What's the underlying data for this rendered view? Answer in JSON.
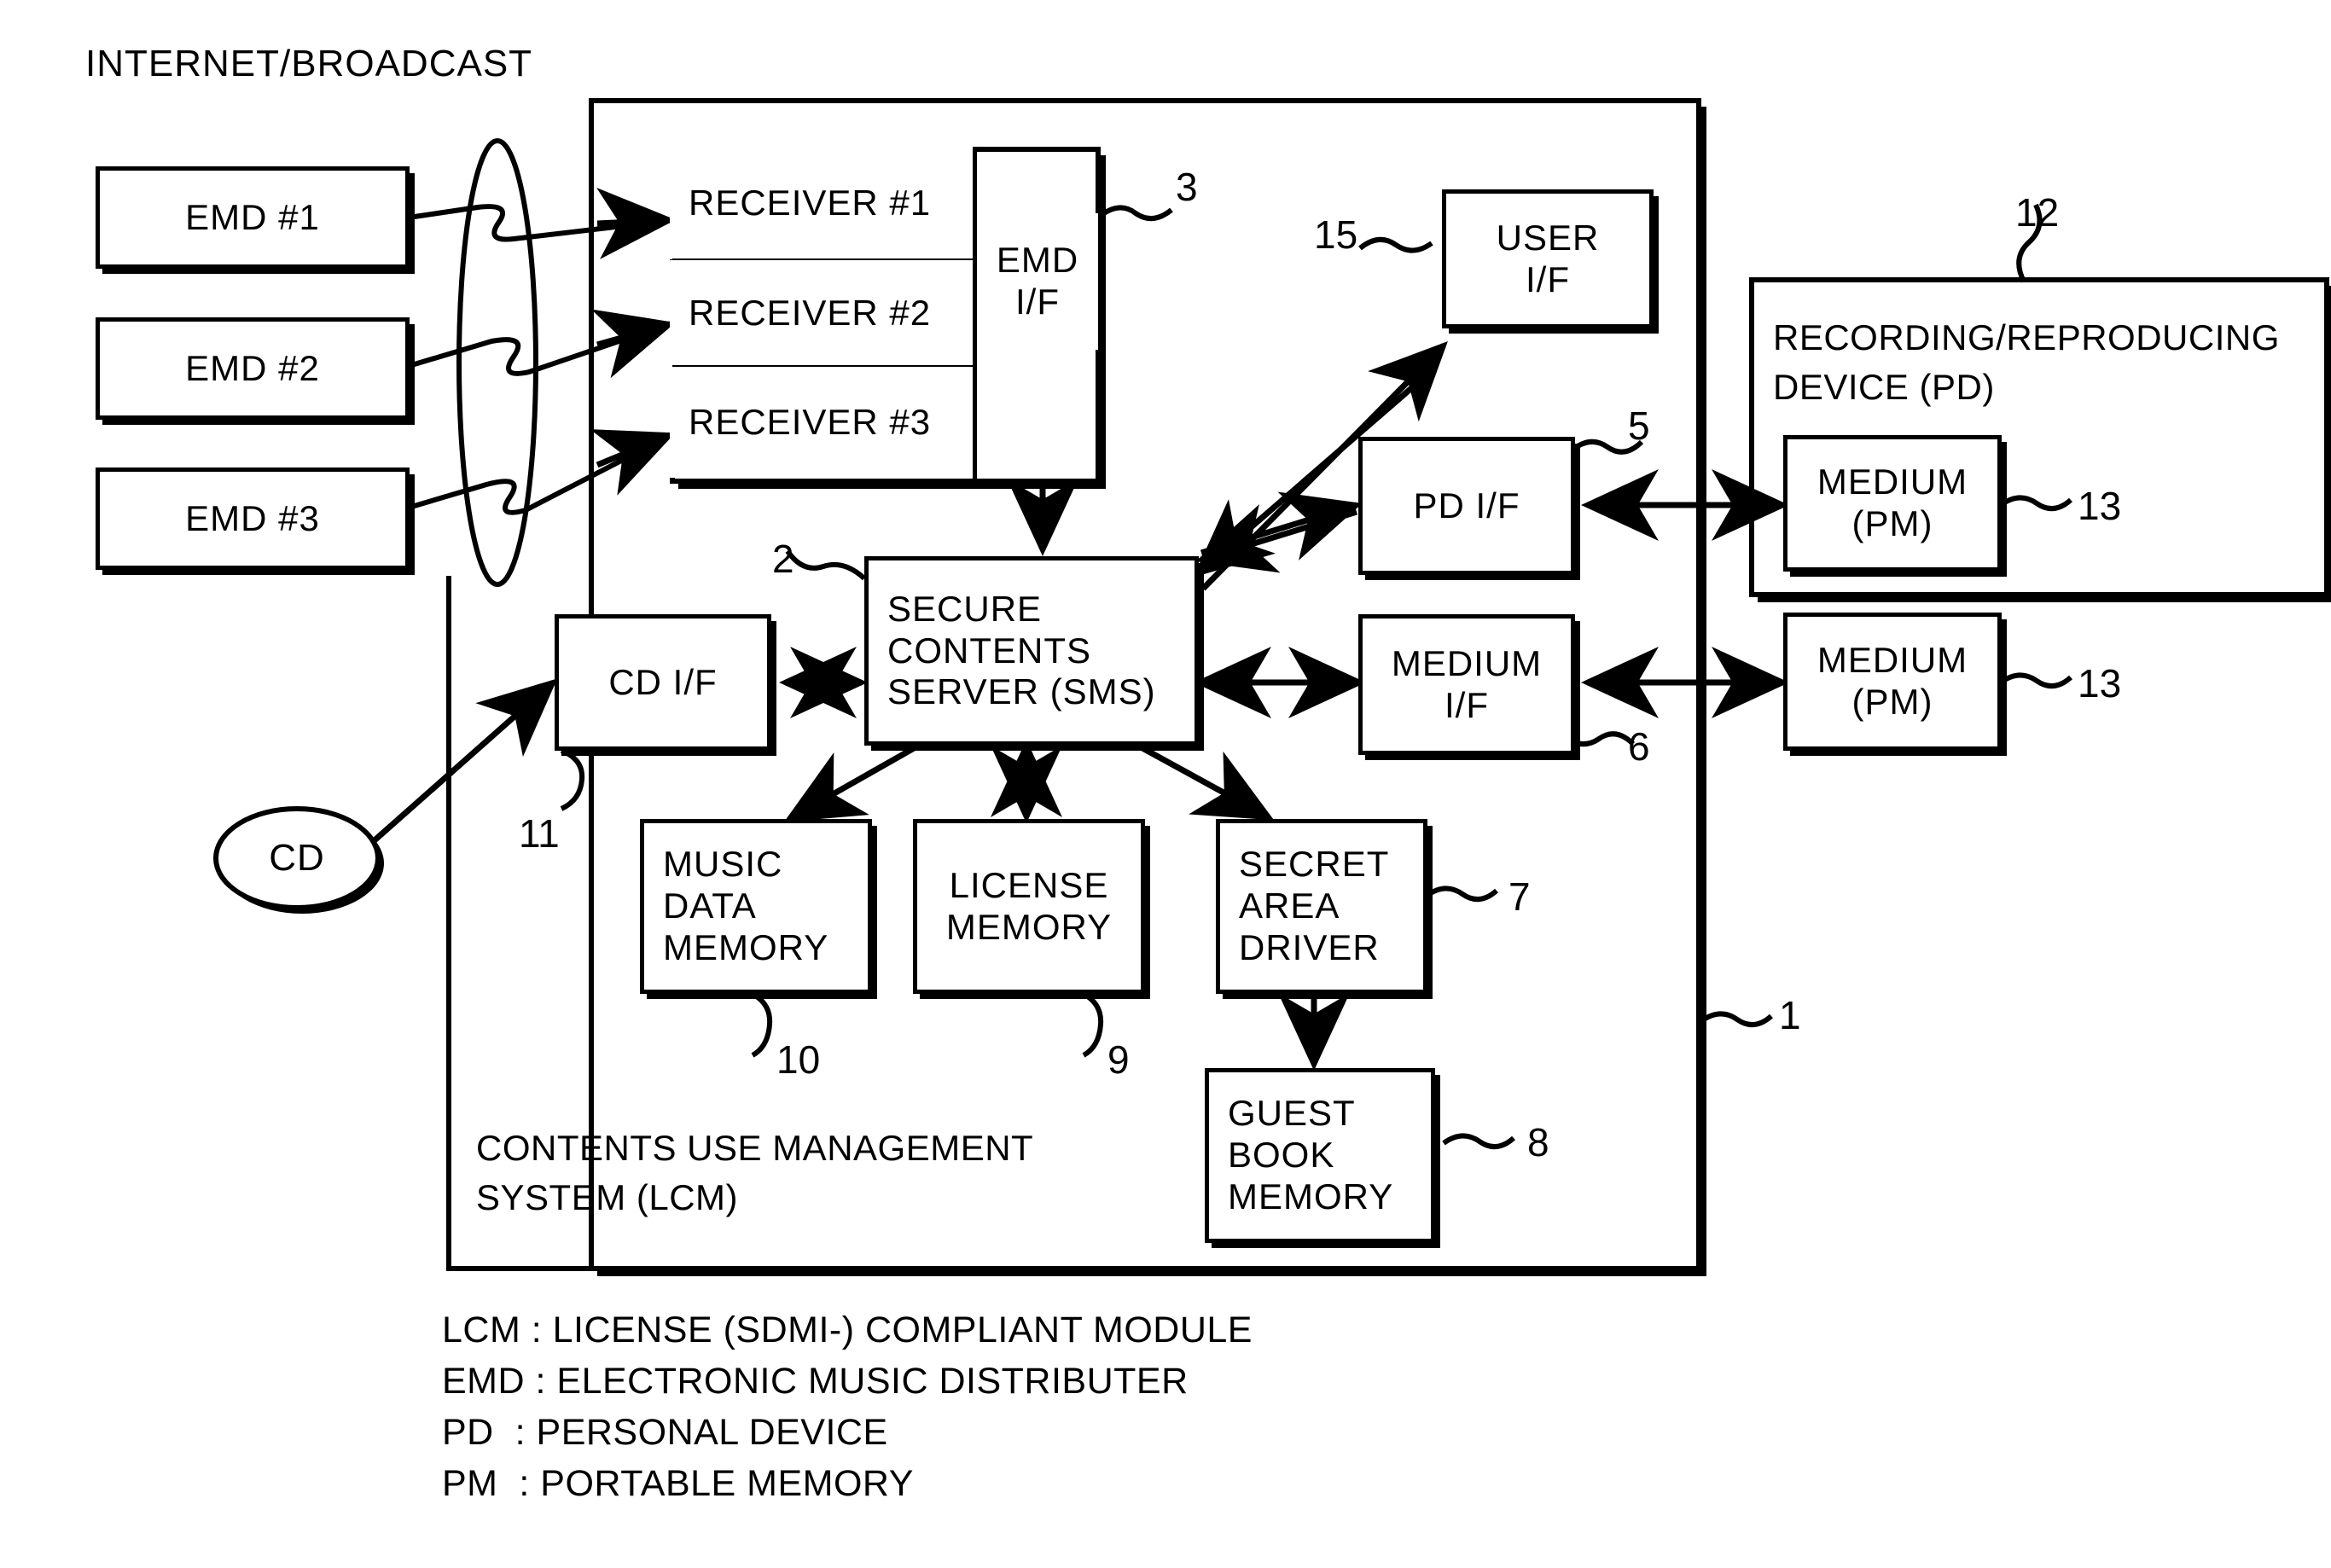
{
  "figure": {
    "top_label": "INTERNET/BROADCAST"
  },
  "sources": {
    "emd_boxes": [
      {
        "label": "EMD #1"
      },
      {
        "label": "EMD #2"
      },
      {
        "label": "EMD #3"
      }
    ],
    "cd": {
      "label": "CD"
    }
  },
  "receiver_unit": {
    "ref": "3",
    "receivers": [
      {
        "label": "RECEIVER #1"
      },
      {
        "label": "RECEIVER #2"
      },
      {
        "label": "RECEIVER #3"
      }
    ],
    "emd_if": {
      "line1": "EMD",
      "line2": "I/F"
    }
  },
  "lcm": {
    "ref": "1",
    "caption_line1": "CONTENTS USE MANAGEMENT",
    "caption_line2": "SYSTEM (LCM)",
    "sms": {
      "ref": "2",
      "line1": "SECURE",
      "line2": "CONTENTS",
      "line3": "SERVER (SMS)"
    },
    "cd_if": {
      "ref": "11",
      "label": "CD I/F"
    },
    "user_if": {
      "ref": "15",
      "line1": "USER",
      "line2": "I/F"
    },
    "pd_if": {
      "ref": "5",
      "label": "PD I/F"
    },
    "medium_if": {
      "ref": "6",
      "line1": "MEDIUM",
      "line2": "I/F"
    },
    "music_data_memory": {
      "ref": "10",
      "line1": "MUSIC",
      "line2": "DATA",
      "line3": "MEMORY"
    },
    "license_memory": {
      "ref": "9",
      "line1": "LICENSE",
      "line2": "MEMORY"
    },
    "secret_area_driver": {
      "ref": "7",
      "line1": "SECRET",
      "line2": "AREA",
      "line3": "DRIVER"
    },
    "guest_book_memory": {
      "ref": "8",
      "line1": "GUEST",
      "line2": "BOOK",
      "line3": "MEMORY"
    }
  },
  "pd_device": {
    "ref": "12",
    "caption_line1": "RECORDING/REPRODUCING",
    "caption_line2": "DEVICE (PD)",
    "medium_inside": {
      "ref": "13",
      "line1": "MEDIUM",
      "line2": "(PM)"
    }
  },
  "medium_standalone": {
    "ref": "13",
    "line1": "MEDIUM",
    "line2": "(PM)"
  },
  "legend": [
    "LCM : LICENSE (SDMI-) COMPLIANT MODULE",
    "EMD : ELECTRONIC MUSIC DISTRIBUTER",
    "PD  : PERSONAL DEVICE",
    "PM  : PORTABLE MEMORY"
  ]
}
